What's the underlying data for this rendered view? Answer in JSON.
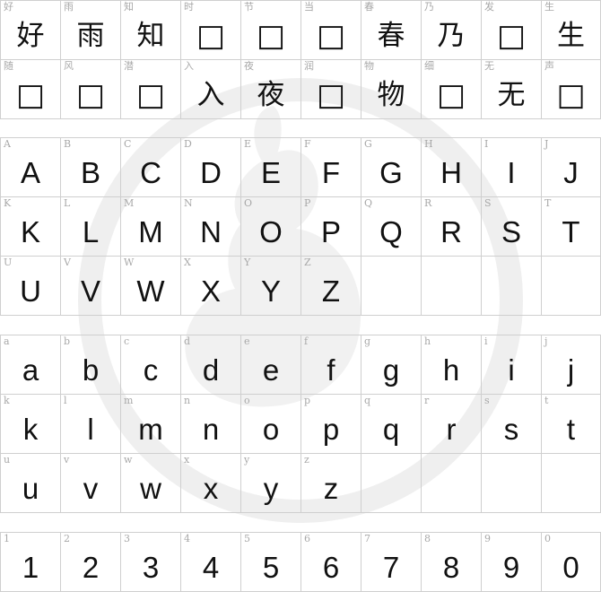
{
  "sections": [
    {
      "rows": [
        {
          "cells": [
            {
              "label": "好",
              "glyph": "好"
            },
            {
              "label": "雨",
              "glyph": "雨"
            },
            {
              "label": "知",
              "glyph": "知"
            },
            {
              "label": "时",
              "glyph": "□"
            },
            {
              "label": "节",
              "glyph": "□"
            },
            {
              "label": "当",
              "glyph": "□"
            },
            {
              "label": "春",
              "glyph": "春"
            },
            {
              "label": "乃",
              "glyph": "乃"
            },
            {
              "label": "发",
              "glyph": "□"
            },
            {
              "label": "生",
              "glyph": "生"
            }
          ]
        },
        {
          "cells": [
            {
              "label": "随",
              "glyph": "□"
            },
            {
              "label": "风",
              "glyph": "□"
            },
            {
              "label": "潜",
              "glyph": "□"
            },
            {
              "label": "入",
              "glyph": "入"
            },
            {
              "label": "夜",
              "glyph": "夜"
            },
            {
              "label": "润",
              "glyph": "□"
            },
            {
              "label": "物",
              "glyph": "物"
            },
            {
              "label": "细",
              "glyph": "□"
            },
            {
              "label": "无",
              "glyph": "无"
            },
            {
              "label": "声",
              "glyph": "□"
            }
          ]
        }
      ]
    },
    {
      "rows": [
        {
          "cells": [
            {
              "label": "A",
              "glyph": "A"
            },
            {
              "label": "B",
              "glyph": "B"
            },
            {
              "label": "C",
              "glyph": "C"
            },
            {
              "label": "D",
              "glyph": "D"
            },
            {
              "label": "E",
              "glyph": "E"
            },
            {
              "label": "F",
              "glyph": "F"
            },
            {
              "label": "G",
              "glyph": "G"
            },
            {
              "label": "H",
              "glyph": "H"
            },
            {
              "label": "I",
              "glyph": "I"
            },
            {
              "label": "J",
              "glyph": "J"
            }
          ]
        },
        {
          "cells": [
            {
              "label": "K",
              "glyph": "K"
            },
            {
              "label": "L",
              "glyph": "L"
            },
            {
              "label": "M",
              "glyph": "M"
            },
            {
              "label": "N",
              "glyph": "N"
            },
            {
              "label": "O",
              "glyph": "O"
            },
            {
              "label": "P",
              "glyph": "P"
            },
            {
              "label": "Q",
              "glyph": "Q"
            },
            {
              "label": "R",
              "glyph": "R"
            },
            {
              "label": "S",
              "glyph": "S"
            },
            {
              "label": "T",
              "glyph": "T"
            }
          ]
        },
        {
          "cells": [
            {
              "label": "U",
              "glyph": "U"
            },
            {
              "label": "V",
              "glyph": "V"
            },
            {
              "label": "W",
              "glyph": "W"
            },
            {
              "label": "X",
              "glyph": "X"
            },
            {
              "label": "Y",
              "glyph": "Y"
            },
            {
              "label": "Z",
              "glyph": "Z"
            },
            {
              "label": "",
              "glyph": ""
            },
            {
              "label": "",
              "glyph": ""
            },
            {
              "label": "",
              "glyph": ""
            },
            {
              "label": "",
              "glyph": ""
            }
          ]
        }
      ]
    },
    {
      "rows": [
        {
          "cells": [
            {
              "label": "a",
              "glyph": "a"
            },
            {
              "label": "b",
              "glyph": "b"
            },
            {
              "label": "c",
              "glyph": "c"
            },
            {
              "label": "d",
              "glyph": "d"
            },
            {
              "label": "e",
              "glyph": "e"
            },
            {
              "label": "f",
              "glyph": "f"
            },
            {
              "label": "g",
              "glyph": "g"
            },
            {
              "label": "h",
              "glyph": "h"
            },
            {
              "label": "i",
              "glyph": "i"
            },
            {
              "label": "j",
              "glyph": "j"
            }
          ]
        },
        {
          "cells": [
            {
              "label": "k",
              "glyph": "k"
            },
            {
              "label": "l",
              "glyph": "l"
            },
            {
              "label": "m",
              "glyph": "m"
            },
            {
              "label": "n",
              "glyph": "n"
            },
            {
              "label": "o",
              "glyph": "o"
            },
            {
              "label": "p",
              "glyph": "p"
            },
            {
              "label": "q",
              "glyph": "q"
            },
            {
              "label": "r",
              "glyph": "r"
            },
            {
              "label": "s",
              "glyph": "s"
            },
            {
              "label": "t",
              "glyph": "t"
            }
          ]
        },
        {
          "cells": [
            {
              "label": "u",
              "glyph": "u"
            },
            {
              "label": "v",
              "glyph": "v"
            },
            {
              "label": "w",
              "glyph": "w"
            },
            {
              "label": "x",
              "glyph": "x"
            },
            {
              "label": "y",
              "glyph": "y"
            },
            {
              "label": "z",
              "glyph": "z"
            },
            {
              "label": "",
              "glyph": ""
            },
            {
              "label": "",
              "glyph": ""
            },
            {
              "label": "",
              "glyph": ""
            },
            {
              "label": "",
              "glyph": ""
            }
          ]
        }
      ]
    },
    {
      "rows": [
        {
          "cells": [
            {
              "label": "1",
              "glyph": "1"
            },
            {
              "label": "2",
              "glyph": "2"
            },
            {
              "label": "3",
              "glyph": "3"
            },
            {
              "label": "4",
              "glyph": "4"
            },
            {
              "label": "5",
              "glyph": "5"
            },
            {
              "label": "6",
              "glyph": "6"
            },
            {
              "label": "7",
              "glyph": "7"
            },
            {
              "label": "8",
              "glyph": "8"
            },
            {
              "label": "9",
              "glyph": "9"
            },
            {
              "label": "0",
              "glyph": "0"
            }
          ]
        }
      ]
    }
  ],
  "colors": {
    "grid": "#cfcfcf",
    "label": "#a8a8a8",
    "glyph": "#111111",
    "watermark": "#f0f0f0"
  }
}
